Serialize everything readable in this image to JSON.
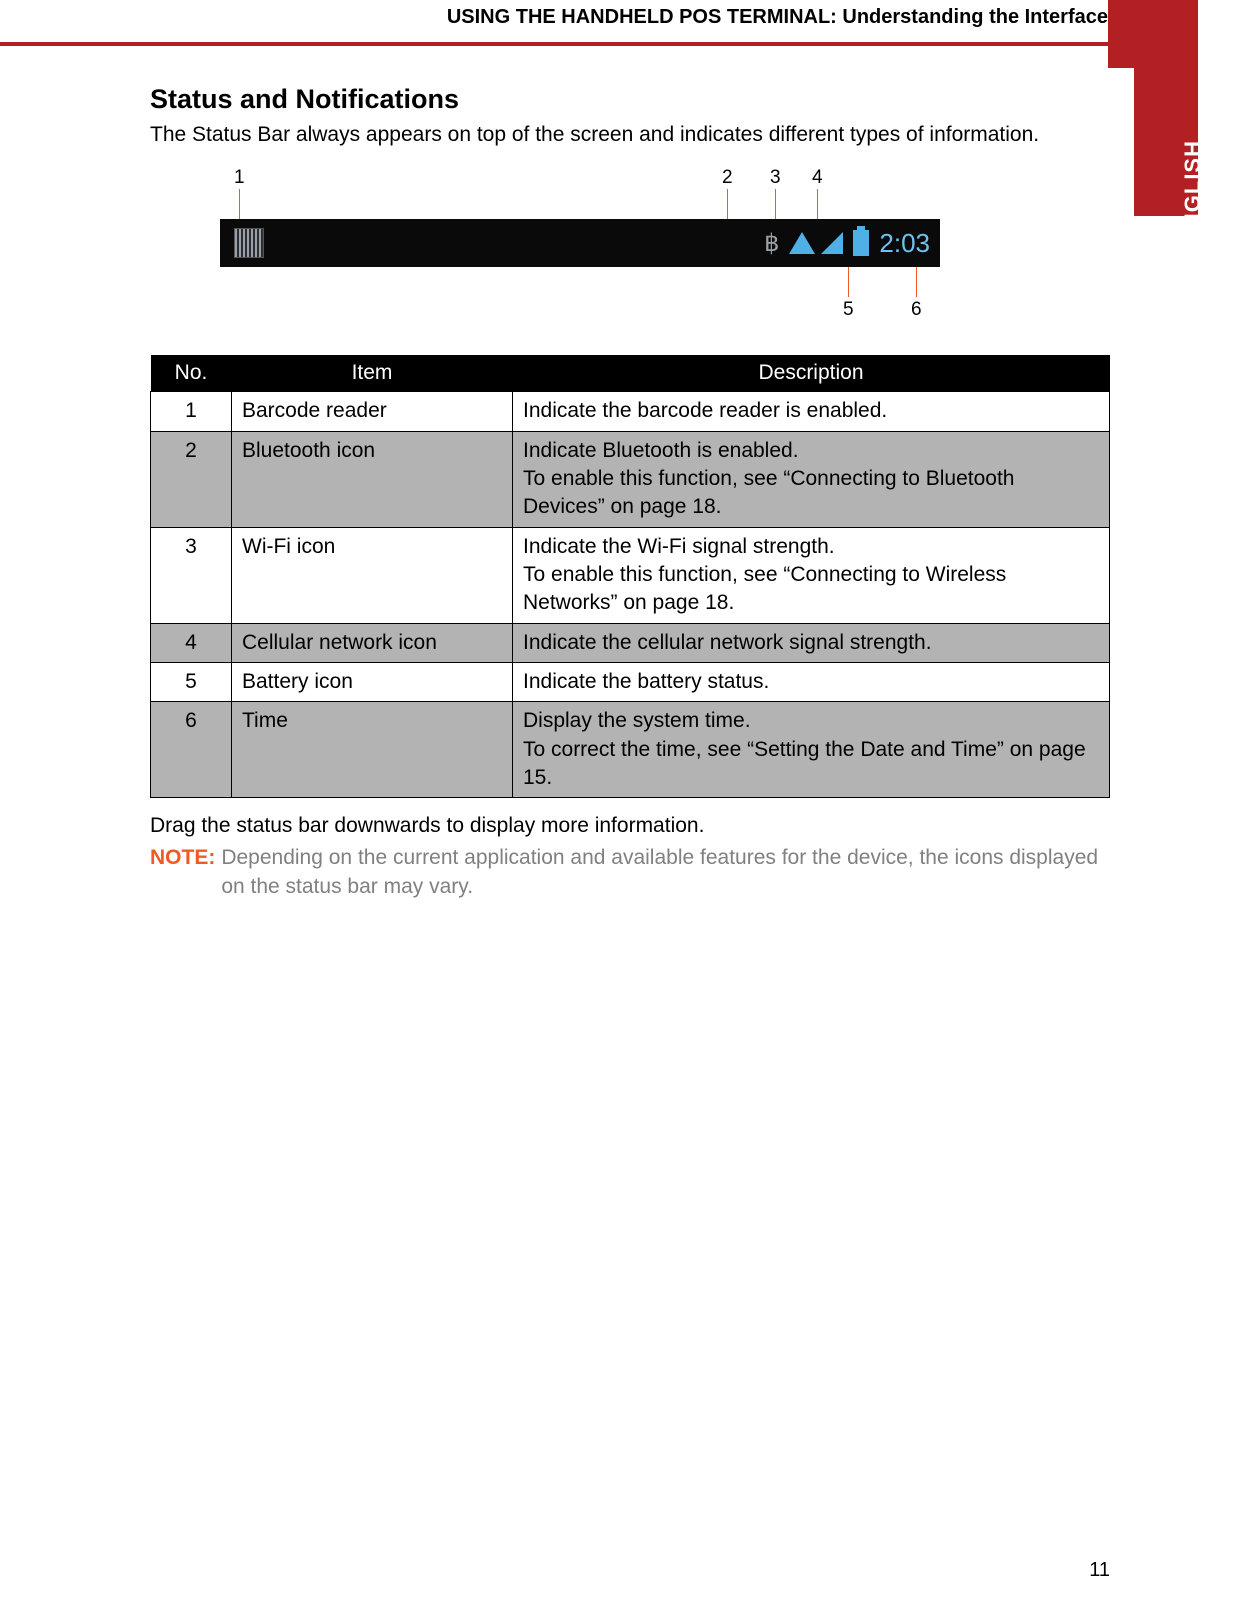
{
  "header": {
    "title": "USING THE HANDHELD POS TERMINAL: Understanding the Interface",
    "language": "ENGLISH"
  },
  "section": {
    "heading": "Status and Notifications",
    "intro": "The Status Bar always appears on top of the screen and indicates different types of information."
  },
  "statusbar": {
    "time": "2:03",
    "callouts": {
      "c1": "1",
      "c2": "2",
      "c3": "3",
      "c4": "4",
      "c5": "5",
      "c6": "6"
    }
  },
  "table": {
    "headers": {
      "no": "No.",
      "item": "Item",
      "desc": "Description"
    },
    "rows": [
      {
        "no": "1",
        "item": "Barcode reader",
        "desc": "Indicate the barcode reader is enabled.",
        "shade": false
      },
      {
        "no": "2",
        "item": "Bluetooth icon",
        "desc": "Indicate Bluetooth is enabled.\nTo enable this function, see “Connecting to Bluetooth Devices” on page 18.",
        "shade": true
      },
      {
        "no": "3",
        "item": "Wi-Fi icon",
        "desc": "Indicate the Wi-Fi signal strength.\nTo enable this function, see “Connecting to Wireless Networks” on page 18.",
        "shade": false
      },
      {
        "no": "4",
        "item": "Cellular network icon",
        "desc": "Indicate the cellular network signal strength.",
        "shade": true
      },
      {
        "no": "5",
        "item": "Battery icon",
        "desc": "Indicate the battery status.",
        "shade": false
      },
      {
        "no": "6",
        "item": "Time",
        "desc": "Display the system time.\nTo correct the time, see “Setting the Date and Time” on page 15.",
        "shade": true
      }
    ]
  },
  "after": "Drag the status bar downwards to display more information.",
  "note": {
    "label": "NOTE:",
    "text": "Depending on the current application and available features for the device, the icons displayed on the status bar may vary."
  },
  "page_number": "11"
}
